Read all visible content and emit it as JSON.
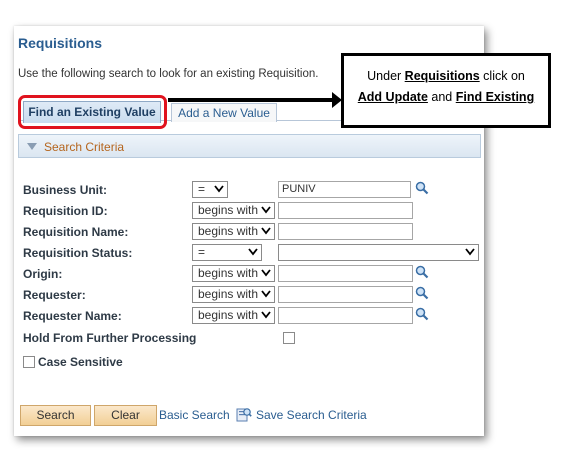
{
  "page": {
    "title": "Requisitions",
    "instructions": "Use the following search to look for an existing Requisition."
  },
  "tabs": {
    "find_existing": "Find an Existing Value",
    "add_new": "Add a New Value"
  },
  "callout": {
    "under": "Under",
    "requisitions": "Requisitions",
    "click_on": "click on",
    "add_update": "Add Update",
    "and": "and",
    "find_existing": "Find Existing"
  },
  "search_criteria": {
    "header": "Search Criteria",
    "fields": {
      "business_unit": {
        "label": "Business Unit:",
        "operator": "=",
        "value": "PUNIV"
      },
      "requisition_id": {
        "label": "Requisition ID:",
        "operator": "begins with",
        "value": ""
      },
      "requisition_name": {
        "label": "Requisition Name:",
        "operator": "begins with",
        "value": ""
      },
      "requisition_status": {
        "label": "Requisition Status:",
        "operator": "=",
        "value": ""
      },
      "origin": {
        "label": "Origin:",
        "operator": "begins with",
        "value": ""
      },
      "requester": {
        "label": "Requester:",
        "operator": "begins with",
        "value": ""
      },
      "requester_name": {
        "label": "Requester Name:",
        "operator": "begins with",
        "value": ""
      }
    },
    "hold_label": "Hold From Further Processing",
    "case_sensitive_label": "Case Sensitive"
  },
  "actions": {
    "search": "Search",
    "clear": "Clear",
    "basic_search": "Basic Search",
    "save_search_criteria": "Save Search Criteria"
  },
  "colors": {
    "title_blue": "#2a5d90",
    "criteria_orange": "#b5651d",
    "highlight_red": "#e0131e",
    "button_fill": "#f2cf95"
  }
}
